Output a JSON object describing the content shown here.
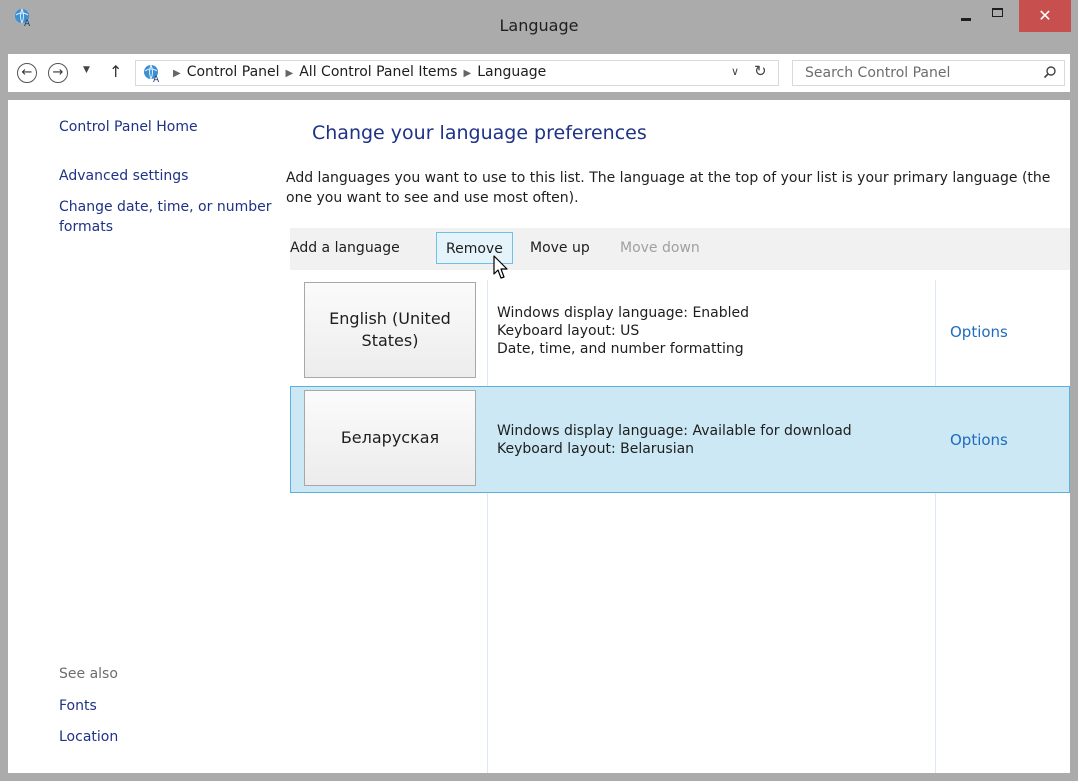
{
  "window": {
    "title": "Language",
    "close_glyph": "✕"
  },
  "nav": {
    "back_glyph": "←",
    "forward_glyph": "→",
    "recent_glyph": "▼",
    "up_glyph": "↑",
    "breadcrumbs": [
      "Control Panel",
      "All Control Panel Items",
      "Language"
    ],
    "dropdown_glyph": "∨",
    "refresh_glyph": "↻",
    "search_placeholder": "Search Control Panel"
  },
  "sidebar": {
    "home": "Control Panel Home",
    "advanced": "Advanced settings",
    "date_time": "Change date, time, or number formats",
    "see_also": "See also",
    "fonts": "Fonts",
    "location": "Location"
  },
  "main": {
    "heading": "Change your language preferences",
    "description": "Add languages you want to use to this list. The language at the top of your list is your primary language (the one you want to see and use most often).",
    "toolbar": {
      "add": "Add a language",
      "remove": "Remove",
      "move_up": "Move up",
      "move_down": "Move down"
    },
    "languages": [
      {
        "name": "English (United States)",
        "info": [
          "Windows display language: Enabled",
          "Keyboard layout: US",
          "Date, time, and number formatting"
        ],
        "options": "Options"
      },
      {
        "name": "Беларуская",
        "info": [
          "Windows display language: Available for download",
          "Keyboard layout: Belarusian"
        ],
        "options": "Options",
        "selected": true
      }
    ]
  },
  "colors": {
    "link": "#1e3287",
    "options_link": "#1e6bc0",
    "selected_row": "#cce8f4",
    "selected_border": "#5cb0df",
    "close_button": "#c7504f"
  },
  "icons": {
    "app": "language-globe-icon",
    "search": "search-icon",
    "pointer": "mouse-cursor-icon"
  }
}
